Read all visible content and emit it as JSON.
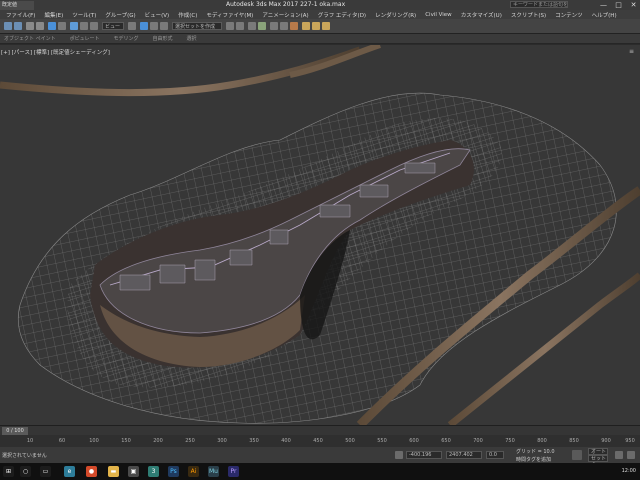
{
  "window": {
    "app_tag": "既定値",
    "title": "Autodesk 3ds Max 2017    227-1 oka.max",
    "search_placeholder": "キーワードまたは語句を入力",
    "controls": [
      "—",
      "□",
      "✕"
    ]
  },
  "menubar": {
    "items": [
      "ファイル(F)",
      "編集(E)",
      "ツール(T)",
      "グループ(G)",
      "ビュー(V)",
      "作成(C)",
      "モディファイヤ(M)",
      "アニメーション(A)",
      "グラフ エディタ(D)",
      "レンダリング(R)",
      "Civil View",
      "カスタマイズ(U)",
      "スクリプト(S)",
      "コンテンツ",
      "ヘルプ(H)"
    ]
  },
  "toolbar": {
    "selection_dropdown": "ビュー",
    "named_selection": "選択セットを作成"
  },
  "ribbon": {
    "tabs": [
      "オブジェクト ペイント",
      "ポピュレート",
      "モデリング",
      "自由形式",
      "選択"
    ]
  },
  "viewport": {
    "label": "[+] [パース] [標準] [既定値シェーディング]",
    "corner": "≡"
  },
  "timeline": {
    "frame_readout": "0 / 100",
    "ticks": [
      "10",
      "60",
      "100",
      "150",
      "200",
      "250",
      "300",
      "350",
      "400",
      "450",
      "500",
      "550",
      "600",
      "650",
      "700",
      "750",
      "800",
      "850",
      "900",
      "950"
    ]
  },
  "statusbar": {
    "selection_info": "選択されていません",
    "x_value": "-400.196",
    "y_value": "2407.402",
    "z_value": "0.0",
    "grid_label": "グリッド = 10.0",
    "add_time_tag": "時間タグを追加",
    "auto_key": "オートキー",
    "set_key": "セットキー"
  },
  "taskbar": {
    "icons": [
      "start-icon",
      "search-icon",
      "chrome-icon",
      "explorer-icon",
      "folder-icon",
      "3dsmax-icon",
      "photoshop-icon",
      "illustrator-icon",
      "mudbox-icon",
      "files-icon"
    ],
    "tray": "12:00"
  },
  "colors": {
    "viewport_bg": "#373737",
    "wireframe": "#8a8a8a",
    "accent": "#4a90d9"
  }
}
